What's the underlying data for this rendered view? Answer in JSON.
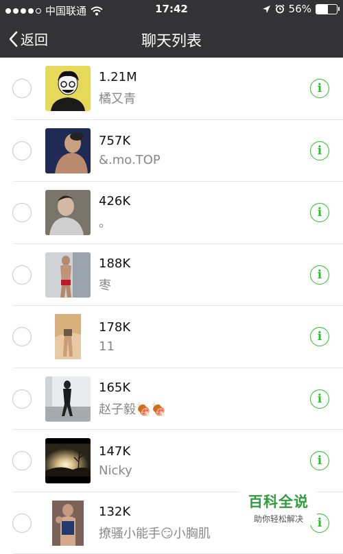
{
  "status": {
    "carrier": "中国联通",
    "time": "17:42",
    "battery": "56%",
    "battery_level": 0.56,
    "signal_dots": 5,
    "signal_filled": 4
  },
  "navbar": {
    "back_label": "返回",
    "title": "聊天列表"
  },
  "list": [
    {
      "size": "1.21M",
      "name": "橘又青"
    },
    {
      "size": "757K",
      "name": "&.mo.TOP"
    },
    {
      "size": "426K",
      "name": "。"
    },
    {
      "size": "188K",
      "name": "枣"
    },
    {
      "size": "178K",
      "name": "11"
    },
    {
      "size": "165K",
      "name": "赵子毅🍖🍖"
    },
    {
      "size": "147K",
      "name": "Nicky"
    },
    {
      "size": "132K",
      "name": "撩骚小能手😏小胸肌"
    }
  ],
  "info_glyph": "i",
  "watermark": {
    "title": "百科全说",
    "subtitle": "助你轻松解决"
  },
  "colors": {
    "bar_bg": "#333234",
    "accent_green": "#1ec51e",
    "watermark_green": "#2f9b3b"
  }
}
